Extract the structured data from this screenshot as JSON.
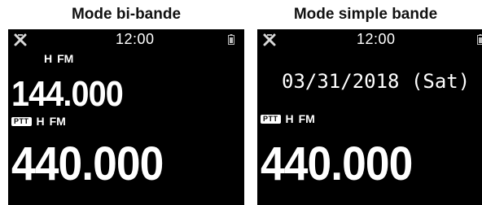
{
  "panels": {
    "dual": {
      "title": "Mode bi-bande",
      "status": {
        "time": "12:00",
        "icons": [
          "antenna-icon",
          "battery-icon"
        ]
      },
      "band_a": {
        "power": "H",
        "mode": "FM",
        "frequency": "144.000"
      },
      "band_b": {
        "ptt": "PTT",
        "power": "H",
        "mode": "FM",
        "frequency": "440.000"
      }
    },
    "single": {
      "title": "Mode simple bande",
      "status": {
        "time": "12:00",
        "icons": [
          "antenna-icon",
          "battery-icon"
        ]
      },
      "date": "03/31/2018 (Sat)",
      "band": {
        "ptt": "PTT",
        "power": "H",
        "mode": "FM",
        "frequency": "440.000"
      }
    }
  },
  "colors": {
    "screen_background": "#000000",
    "screen_text": "#ffffff",
    "page_background": "#ffffff",
    "title_text": "#111111"
  }
}
